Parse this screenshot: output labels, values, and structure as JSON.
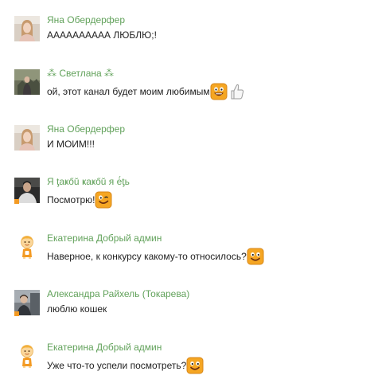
{
  "comments": [
    {
      "author": "Яна Обердерфер",
      "text": "АААААААААА ЛЮБЛЮ;!",
      "avatar": "photo-avatar",
      "emojis": []
    },
    {
      "author": "⁂ Светлана ⁂",
      "text": "ой, этот канал будет моим любимым",
      "avatar": "photo-avatar",
      "emojis": [
        "laughing-smiley-icon",
        "thumbs-up-icon"
      ]
    },
    {
      "author": "Яна Обердерфер",
      "text": "И МОИМ!!!",
      "avatar": "photo-avatar",
      "emojis": []
    },
    {
      "author": "Я ƫаҝőŭ ҝаҝőŭ я ė́ƫь",
      "text": "Посмотрю!",
      "avatar": "photo-avatar",
      "emojis": [
        "winking-smiley-icon"
      ]
    },
    {
      "author": "Екатерина Добрый админ",
      "text": "Наверное, к конкурсу какому-то относилось?",
      "avatar": "ok-mascot-avatar",
      "emojis": [
        "grinning-smiley-icon"
      ]
    },
    {
      "author": "Александра Райхель (Токарева)",
      "text": "люблю кошек",
      "avatar": "photo-avatar",
      "emojis": []
    },
    {
      "author": "Екатерина Добрый админ",
      "text": "Уже что-то успели посмотреть?",
      "avatar": "ok-mascot-avatar",
      "emojis": [
        "grinning-smiley-icon"
      ]
    }
  ],
  "colors": {
    "author": "#62a25b",
    "text": "#222222",
    "online": "#f39a23",
    "emoji": "#f5a623"
  }
}
